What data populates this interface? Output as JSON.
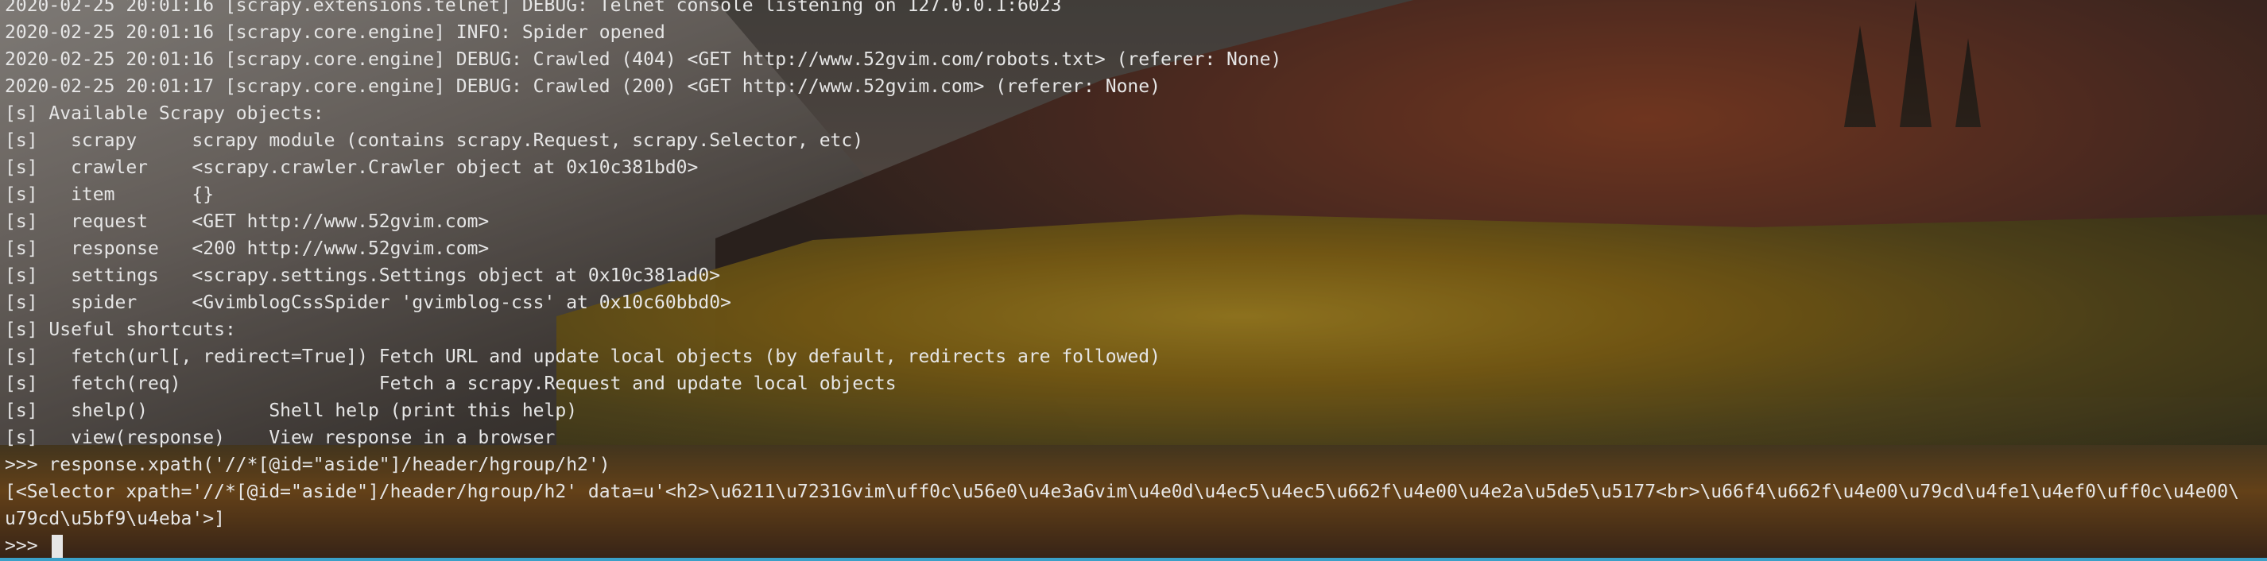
{
  "terminal": {
    "lines": [
      "2020-02-25 20:01:16 [scrapy.extensions.telnet] DEBUG: Telnet console listening on 127.0.0.1:6023",
      "2020-02-25 20:01:16 [scrapy.core.engine] INFO: Spider opened",
      "2020-02-25 20:01:16 [scrapy.core.engine] DEBUG: Crawled (404) <GET http://www.52gvim.com/robots.txt> (referer: None)",
      "2020-02-25 20:01:17 [scrapy.core.engine] DEBUG: Crawled (200) <GET http://www.52gvim.com> (referer: None)",
      "[s] Available Scrapy objects:",
      "[s]   scrapy     scrapy module (contains scrapy.Request, scrapy.Selector, etc)",
      "[s]   crawler    <scrapy.crawler.Crawler object at 0x10c381bd0>",
      "[s]   item       {}",
      "[s]   request    <GET http://www.52gvim.com>",
      "[s]   response   <200 http://www.52gvim.com>",
      "[s]   settings   <scrapy.settings.Settings object at 0x10c381ad0>",
      "[s]   spider     <GvimblogCssSpider 'gvimblog-css' at 0x10c60bbd0>",
      "[s] Useful shortcuts:",
      "[s]   fetch(url[, redirect=True]) Fetch URL and update local objects (by default, redirects are followed)",
      "[s]   fetch(req)                  Fetch a scrapy.Request and update local objects",
      "[s]   shelp()           Shell help (print this help)",
      "[s]   view(response)    View response in a browser",
      ">>> response.xpath('//*[@id=\"aside\"]/header/hgroup/h2')",
      "[<Selector xpath='//*[@id=\"aside\"]/header/hgroup/h2' data=u'<h2>\\u6211\\u7231Gvim\\uff0c\\u56e0\\u4e3aGvim\\u4e0d\\u4ec5\\u4ec5\\u662f\\u4e00\\u4e2a\\u5de5\\u5177<br>\\u66f4\\u662f\\u4e00\\u79cd\\u4fe1\\u4ef0\\uff0c\\u4e00\\",
      "u79cd\\u5bf9\\u4eba'>]"
    ],
    "prompt": ">>> "
  }
}
